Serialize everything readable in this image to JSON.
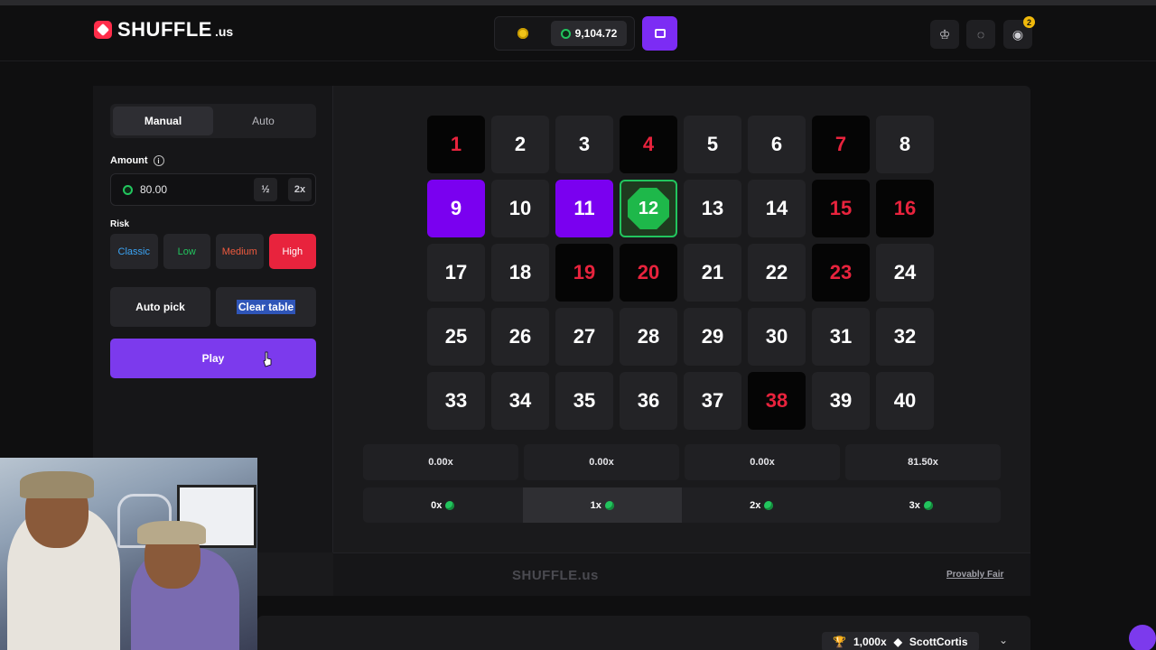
{
  "header": {
    "brand": "SHUFFLE",
    "brand_tld": ".us",
    "balance": "9,104.72",
    "notification_count": "2"
  },
  "sidebar": {
    "tabs": [
      "Manual",
      "Auto"
    ],
    "active_tab": "Manual",
    "amount_label": "Amount",
    "amount_value": "80.00",
    "half_label": "½",
    "double_label": "2x",
    "risk_label": "Risk",
    "risk_options": [
      "Classic",
      "Low",
      "Medium",
      "High"
    ],
    "selected_risk": "High",
    "auto_pick_label": "Auto pick",
    "clear_table_label": "Clear table",
    "play_label": "Play"
  },
  "board": {
    "tiles": [
      {
        "n": "1",
        "state": "hit"
      },
      {
        "n": "2",
        "state": ""
      },
      {
        "n": "3",
        "state": ""
      },
      {
        "n": "4",
        "state": "hit"
      },
      {
        "n": "5",
        "state": ""
      },
      {
        "n": "6",
        "state": ""
      },
      {
        "n": "7",
        "state": "hit"
      },
      {
        "n": "8",
        "state": ""
      },
      {
        "n": "9",
        "state": "picked"
      },
      {
        "n": "10",
        "state": ""
      },
      {
        "n": "11",
        "state": "picked"
      },
      {
        "n": "12",
        "state": "gem"
      },
      {
        "n": "13",
        "state": ""
      },
      {
        "n": "14",
        "state": ""
      },
      {
        "n": "15",
        "state": "hit"
      },
      {
        "n": "16",
        "state": "hit"
      },
      {
        "n": "17",
        "state": ""
      },
      {
        "n": "18",
        "state": ""
      },
      {
        "n": "19",
        "state": "hit"
      },
      {
        "n": "20",
        "state": "hit"
      },
      {
        "n": "21",
        "state": ""
      },
      {
        "n": "22",
        "state": ""
      },
      {
        "n": "23",
        "state": "hit"
      },
      {
        "n": "24",
        "state": ""
      },
      {
        "n": "25",
        "state": ""
      },
      {
        "n": "26",
        "state": ""
      },
      {
        "n": "27",
        "state": ""
      },
      {
        "n": "28",
        "state": ""
      },
      {
        "n": "29",
        "state": ""
      },
      {
        "n": "30",
        "state": ""
      },
      {
        "n": "31",
        "state": ""
      },
      {
        "n": "32",
        "state": ""
      },
      {
        "n": "33",
        "state": ""
      },
      {
        "n": "34",
        "state": ""
      },
      {
        "n": "35",
        "state": ""
      },
      {
        "n": "36",
        "state": ""
      },
      {
        "n": "37",
        "state": ""
      },
      {
        "n": "38",
        "state": "hit"
      },
      {
        "n": "39",
        "state": ""
      },
      {
        "n": "40",
        "state": ""
      }
    ]
  },
  "payouts": {
    "multipliers": [
      "0.00x",
      "0.00x",
      "0.00x",
      "81.50x"
    ],
    "hits": [
      "0x",
      "1x",
      "2x",
      "3x"
    ],
    "active_hits": "1x"
  },
  "footer": {
    "logo": "SHUFFLE.us",
    "provably_fair": "Provably Fair"
  },
  "bet_feed": {
    "amount": "1,000x",
    "user": "ScottCortis"
  },
  "colors": {
    "accent_purple": "#7c3aed",
    "hit_red": "#e8233d",
    "gem_green": "#22c55e"
  }
}
